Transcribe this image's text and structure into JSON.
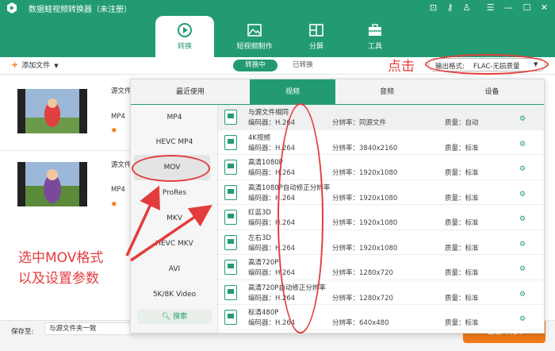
{
  "window": {
    "title": "数据蛙视频转换器（未注册）",
    "controls": [
      "cart-icon",
      "key-icon",
      "user-icon",
      "menu-icon",
      "minimize-icon",
      "maximize-icon",
      "close-icon"
    ]
  },
  "nav_tabs": [
    {
      "label": "转换",
      "icon": "convert-icon",
      "active": true
    },
    {
      "label": "短视频制作",
      "icon": "image-icon",
      "active": false
    },
    {
      "label": "分屏",
      "icon": "split-screen-icon",
      "active": false
    },
    {
      "label": "工具",
      "icon": "toolbox-icon",
      "active": false
    }
  ],
  "toolbar": {
    "add_file": "添加文件",
    "segment": {
      "converting": "转换中",
      "converted": "已转换"
    },
    "output_format_label": "输出格式:",
    "output_format_value": "FLAC-无损质量"
  },
  "files": [
    {
      "name": "源文件",
      "format": "MP4"
    },
    {
      "name": "源文件",
      "format": "MP4"
    }
  ],
  "format_panel": {
    "tabs": [
      "最近使用",
      "视频",
      "音频",
      "设备"
    ],
    "active_tab": "视频",
    "formats": [
      "MP4",
      "HEVC MP4",
      "MOV",
      "ProRes",
      "MKV",
      "HEVC MKV",
      "AVI",
      "5K/8K Video"
    ],
    "selected_format": "MOV",
    "search_label": "搜索",
    "options": [
      {
        "name": "与源文件相同",
        "encoder": "编码器：H.264",
        "resolution": "分辨率：同源文件",
        "quality": "质量：自动"
      },
      {
        "name": "4K视频",
        "encoder": "编码器：H.264",
        "resolution": "分辨率：3840x2160",
        "quality": "质量：标准"
      },
      {
        "name": "高清1080P",
        "encoder": "编码器：H.264",
        "resolution": "分辨率：1920x1080",
        "quality": "质量：标准"
      },
      {
        "name": "高清1080P自动修正分辨率",
        "encoder": "编码器：H.264",
        "resolution": "分辨率：1920x1080",
        "quality": "质量：标准"
      },
      {
        "name": "红蓝3D",
        "encoder": "编码器：H.264",
        "resolution": "分辨率：1920x1080",
        "quality": "质量：标准"
      },
      {
        "name": "左右3D",
        "encoder": "编码器：H.264",
        "resolution": "分辨率：1920x1080",
        "quality": "质量：标准"
      },
      {
        "name": "高清720P",
        "encoder": "编码器：H.264",
        "resolution": "分辨率：1280x720",
        "quality": "质量：标准"
      },
      {
        "name": "高清720P自动修正分辨率",
        "encoder": "编码器：H.264",
        "resolution": "分辨率：1280x720",
        "quality": "质量：标准"
      },
      {
        "name": "标清480P",
        "encoder": "编码器：H.264",
        "resolution": "分辨率：640x480",
        "quality": "质量：标准"
      }
    ]
  },
  "annotations": {
    "click": "点击",
    "select_line1": "选中MOV格式",
    "select_line2": "以及设置参数"
  },
  "bottom": {
    "save_to_label": "保存至:",
    "save_to_value": "与源文件夹一致",
    "convert_all": "全部转换"
  },
  "colors": {
    "brand": "#239b72",
    "accent": "#f07a18",
    "annotation": "#e43c3c"
  }
}
